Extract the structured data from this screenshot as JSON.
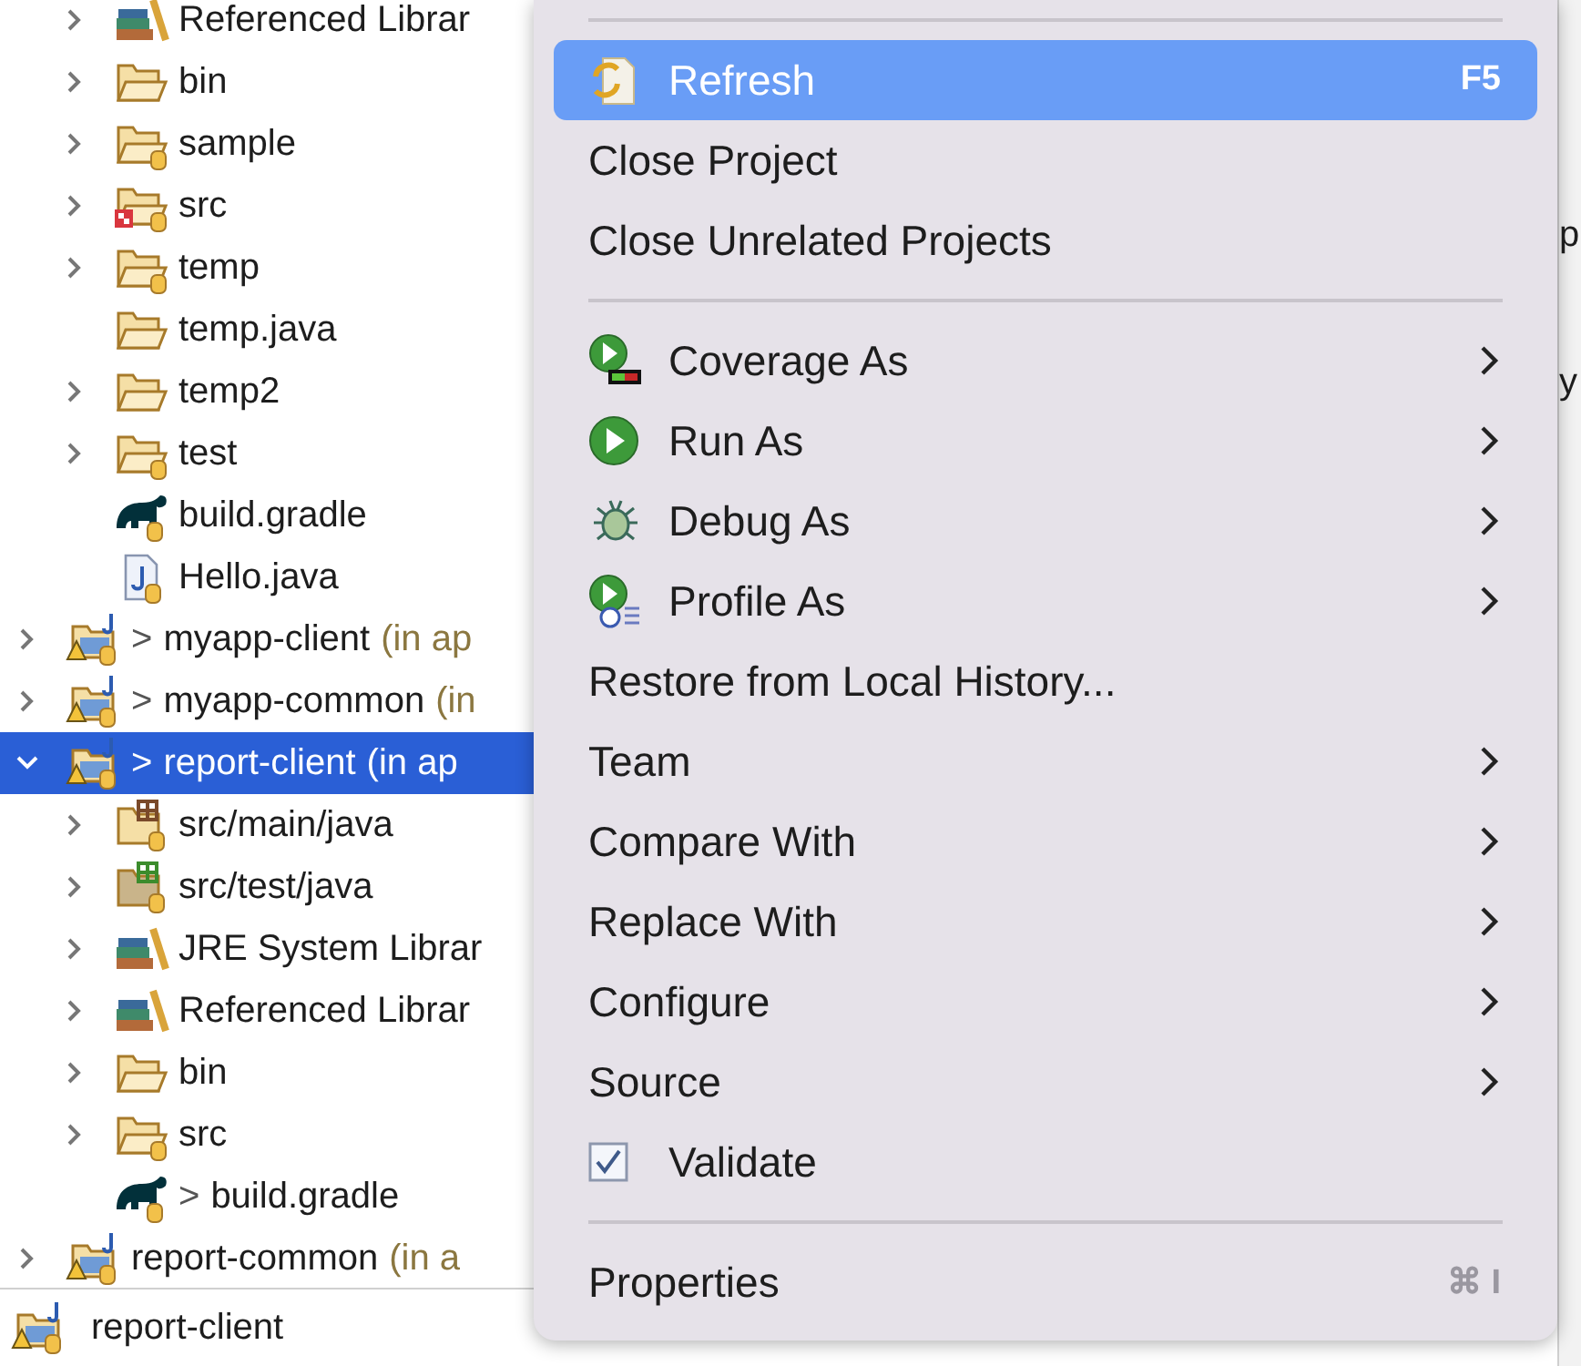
{
  "tree": {
    "continued_items": [
      {
        "label": "Referenced Librar",
        "kind": "library",
        "expanded": false
      },
      {
        "label": "bin",
        "kind": "folder",
        "expanded": false
      },
      {
        "label": "sample",
        "kind": "folder-managed",
        "expanded": false
      },
      {
        "label": "src",
        "kind": "folder-error",
        "expanded": false
      },
      {
        "label": "temp",
        "kind": "folder-managed",
        "expanded": false
      },
      {
        "label": "temp.java",
        "kind": "folder"
      },
      {
        "label": "temp2",
        "kind": "folder",
        "expanded": false
      },
      {
        "label": "test",
        "kind": "folder-managed",
        "expanded": false
      },
      {
        "label": "build.gradle",
        "kind": "gradle"
      },
      {
        "label": "Hello.java",
        "kind": "java-file"
      }
    ],
    "projects": [
      {
        "label": "myapp-client",
        "decorator": ">",
        "suffix": "(in ap",
        "kind": "project",
        "expanded": false,
        "selected": false
      },
      {
        "label": "myapp-common",
        "decorator": ">",
        "suffix": "(in",
        "kind": "project",
        "expanded": false,
        "selected": false
      },
      {
        "label": "report-client",
        "decorator": ">",
        "suffix": "(in ap",
        "kind": "project",
        "expanded": true,
        "selected": true,
        "children": [
          {
            "label": "src/main/java",
            "kind": "source-folder",
            "expanded": false
          },
          {
            "label": "src/test/java",
            "kind": "test-folder",
            "expanded": false
          },
          {
            "label": "JRE System Librar",
            "kind": "library",
            "expanded": false
          },
          {
            "label": "Referenced Librar",
            "kind": "library",
            "expanded": false
          },
          {
            "label": "bin",
            "kind": "folder",
            "expanded": false
          },
          {
            "label": "src",
            "kind": "folder-managed",
            "expanded": false
          },
          {
            "label": "build.gradle",
            "decorator": ">",
            "kind": "gradle"
          }
        ]
      },
      {
        "label": "report-common",
        "suffix": "(in a",
        "kind": "project",
        "expanded": false,
        "selected": false
      }
    ]
  },
  "status_bar": {
    "label": "report-client"
  },
  "background_fragments": [
    "p",
    "y"
  ],
  "context_menu": [
    {
      "kind": "separator"
    },
    {
      "kind": "refresh",
      "label": "Refresh",
      "shortcut": "F5",
      "selected": true,
      "submenu": false
    },
    {
      "kind": "item",
      "label": "Close Project",
      "selected": false,
      "submenu": false
    },
    {
      "kind": "item",
      "label": "Close Unrelated Projects",
      "selected": false,
      "submenu": false
    },
    {
      "kind": "separator"
    },
    {
      "kind": "coverage",
      "label": "Coverage As",
      "selected": false,
      "submenu": true
    },
    {
      "kind": "run",
      "label": "Run As",
      "selected": false,
      "submenu": true
    },
    {
      "kind": "debug",
      "label": "Debug As",
      "selected": false,
      "submenu": true
    },
    {
      "kind": "profile",
      "label": "Profile As",
      "selected": false,
      "submenu": true
    },
    {
      "kind": "item",
      "label": "Restore from Local History...",
      "selected": false,
      "submenu": false
    },
    {
      "kind": "item",
      "label": "Team",
      "selected": false,
      "submenu": true
    },
    {
      "kind": "item",
      "label": "Compare With",
      "selected": false,
      "submenu": true
    },
    {
      "kind": "item",
      "label": "Replace With",
      "selected": false,
      "submenu": true
    },
    {
      "kind": "item",
      "label": "Configure",
      "selected": false,
      "submenu": true
    },
    {
      "kind": "item",
      "label": "Source",
      "selected": false,
      "submenu": true
    },
    {
      "kind": "checkbox",
      "label": "Validate",
      "checked": true,
      "selected": false,
      "submenu": false
    },
    {
      "kind": "separator"
    },
    {
      "kind": "item",
      "label": "Properties",
      "shortcut": "⌘ I",
      "selected": false,
      "submenu": false
    }
  ]
}
